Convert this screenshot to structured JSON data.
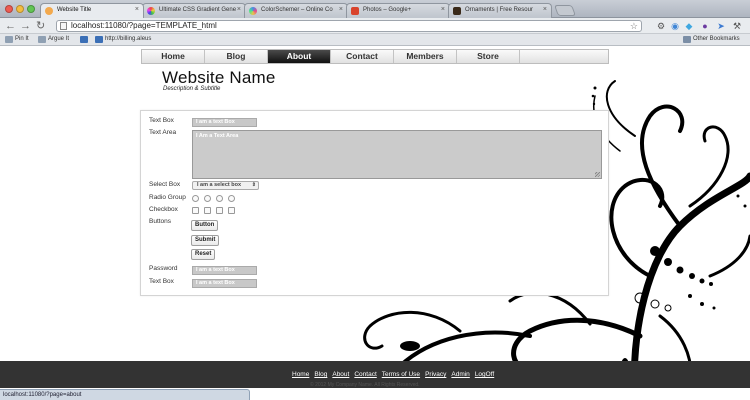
{
  "browser": {
    "tabs": [
      {
        "title": "Website Title",
        "active": true,
        "color": "#f3a94d"
      },
      {
        "title": "Ultimate CSS Gradient Gene",
        "active": false,
        "color": "#d44fb3"
      },
      {
        "title": "ColorSchemer – Online Co",
        "active": false,
        "color": "#4b8be6"
      },
      {
        "title": "Photos – Google+",
        "active": false,
        "color": "#d9432c"
      },
      {
        "title": "Ornaments | Free Resour",
        "active": false,
        "color": "#3a2a1a"
      }
    ],
    "url": "localhost:11080/?page=TEMPLATE_html",
    "bookmarks": [
      {
        "label": "Pin It",
        "color": "#8fa0b3"
      },
      {
        "label": "Argue It",
        "color": "#8fa0b3"
      },
      {
        "label": "",
        "color": "#3b6fb6"
      },
      {
        "label": "http://billing.aleus",
        "color": "#3b6fb6"
      }
    ],
    "other_bookmarks": "Other Bookmarks",
    "status_url": "localhost:11080/?page=about"
  },
  "nav": {
    "items": [
      {
        "label": "Home",
        "active": false
      },
      {
        "label": "Blog",
        "active": false
      },
      {
        "label": "About",
        "active": true
      },
      {
        "label": "Contact",
        "active": false
      },
      {
        "label": "Members",
        "active": false
      },
      {
        "label": "Store",
        "active": false
      },
      {
        "label": "",
        "active": false
      }
    ]
  },
  "site": {
    "title": "Website Name",
    "subtitle": "Description & Subtitle"
  },
  "form": {
    "textbox_label": "Text Box",
    "textbox_value": "I am a text Box",
    "textarea_label": "Text Area",
    "textarea_value": "I Am a Text Area",
    "select_label": "Select Box",
    "select_value": "I am a select box",
    "radio_label": "Radio Group",
    "checkbox_label": "Checkbox",
    "buttons_label": "Buttons",
    "button_label": "Button",
    "submit_label": "Submit",
    "reset_label": "Reset",
    "password_label": "Password",
    "password_value": "I am a text Box",
    "textbox2_label": "Text Box",
    "textbox2_value": "I am a text Box"
  },
  "footer": {
    "links": [
      "Home",
      "Blog",
      "About",
      "Contact",
      "Terms of Use",
      "Privacy",
      "Admin",
      "LogOff"
    ],
    "copyright": "© 2012 My Company Name. All Rights Reserved."
  },
  "colors": {
    "nav_active": "#1a1a1a",
    "footer_bg": "#333333",
    "input_fill": "#c8c8c8"
  }
}
